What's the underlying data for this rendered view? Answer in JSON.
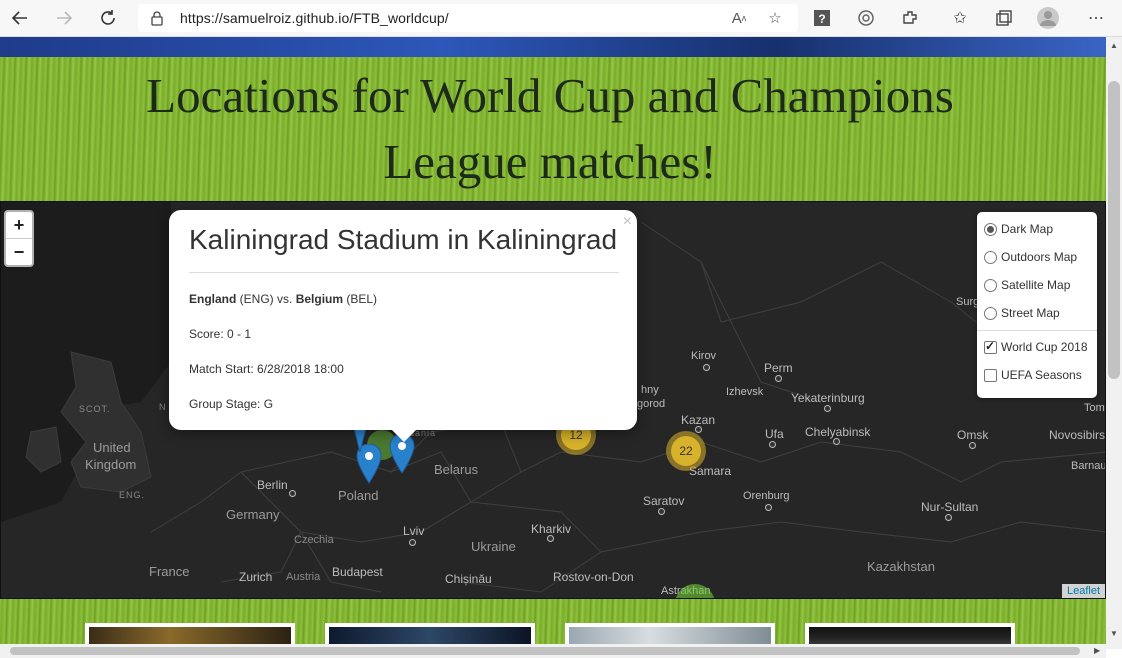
{
  "browser": {
    "url": "https://samuelroiz.github.io/FTB_worldcup/",
    "icons": [
      "back-icon",
      "forward-icon",
      "refresh-icon",
      "lock-icon",
      "read-aloud-icon",
      "add-favorite-icon",
      "help-icon",
      "copilot-icon",
      "extensions-icon",
      "favorites-icon",
      "collections-icon",
      "profile-icon",
      "more-icon"
    ]
  },
  "page": {
    "title_line1": "Locations for World Cup and Champions",
    "title_line2": "League matches!"
  },
  "map": {
    "zoom_in": "+",
    "zoom_out": "−",
    "attribution": "Leaflet",
    "labels": {
      "united_kingdom_1": "United",
      "united_kingdom_2": "Kingdom",
      "scot": "SCOT.",
      "eng": "ENG.",
      "germany": "Germany",
      "berlin": "Berlin",
      "poland": "Poland",
      "belarus": "Belarus",
      "czechia": "Czechia",
      "france": "France",
      "zurich": "Zurich",
      "austria": "Austria",
      "budapest": "Budapest",
      "lviv": "Lviv",
      "ukraine": "Ukraine",
      "kharkiv": "Kharkiv",
      "chisinau": "Chișinău",
      "rostov": "Rostov-on-Don",
      "astrakhan": "Astrakhan",
      "saratov": "Saratov",
      "samara": "Samara",
      "kazan": "Kazan",
      "nizhny_1": "hny",
      "nizhny_2": "gorod",
      "kirov": "Kirov",
      "perm": "Perm",
      "izhevsk": "Izhevsk",
      "yekaterinburg": "Yekaterinburg",
      "ufa": "Ufa",
      "chelyabinsk": "Chelyabinsk",
      "orenburg": "Orenburg",
      "omsk": "Omsk",
      "novosibirsk": "Novosibirsk",
      "barnaul": "Barnau",
      "nur_sultan": "Nur-Sultan",
      "kazakhstan": "Kazakhstan",
      "surgut": "Surg",
      "tomsk": "Tom",
      "lithuania": "uania",
      "n_edge": "N"
    },
    "clusters": [
      {
        "count": "12"
      },
      {
        "count": "22"
      }
    ],
    "layers": {
      "base": [
        {
          "label": "Dark Map",
          "selected": true
        },
        {
          "label": "Outdoors Map",
          "selected": false
        },
        {
          "label": "Satellite Map",
          "selected": false
        },
        {
          "label": "Street Map",
          "selected": false
        }
      ],
      "overlays": [
        {
          "label": "World Cup 2018",
          "checked": true
        },
        {
          "label": "UEFA Seasons",
          "checked": false
        }
      ]
    },
    "popup": {
      "close": "×",
      "title": "Kaliningrad Stadium in Kaliningrad",
      "home_team": "England",
      "home_code": " (ENG) vs. ",
      "away_team": "Belgium",
      "away_code": " (BEL)",
      "score": "Score: 0 - 1",
      "match_start": "Match Start: 6/28/2018 18:00",
      "group_stage": "Group Stage: G"
    },
    "colors": {
      "background": "#262626",
      "cluster_fill": "#d8b22a",
      "pin": "#2a81cb"
    }
  }
}
